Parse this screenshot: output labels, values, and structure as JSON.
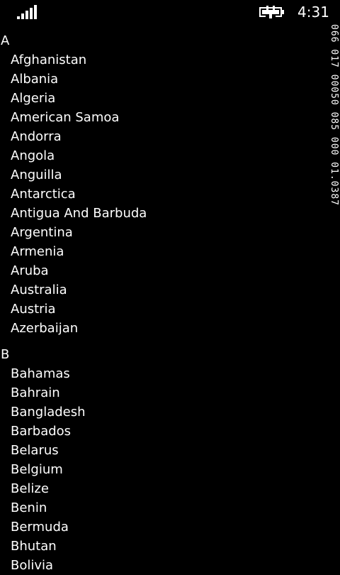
{
  "status_bar": {
    "time": "4:31",
    "signal_icon": "signal-strength-icon",
    "battery_icon": "battery-charging-icon"
  },
  "side_debug": "066 017 00050 085 000 01.0387",
  "groups": [
    {
      "letter": "A",
      "items": [
        "Afghanistan",
        "Albania",
        "Algeria",
        "American Samoa",
        "Andorra",
        "Angola",
        "Anguilla",
        "Antarctica",
        "Antigua And Barbuda",
        "Argentina",
        "Armenia",
        "Aruba",
        "Australia",
        "Austria",
        "Azerbaijan"
      ]
    },
    {
      "letter": "B",
      "items": [
        "Bahamas",
        "Bahrain",
        "Bangladesh",
        "Barbados",
        "Belarus",
        "Belgium",
        "Belize",
        "Benin",
        "Bermuda",
        "Bhutan",
        "Bolivia"
      ]
    }
  ]
}
